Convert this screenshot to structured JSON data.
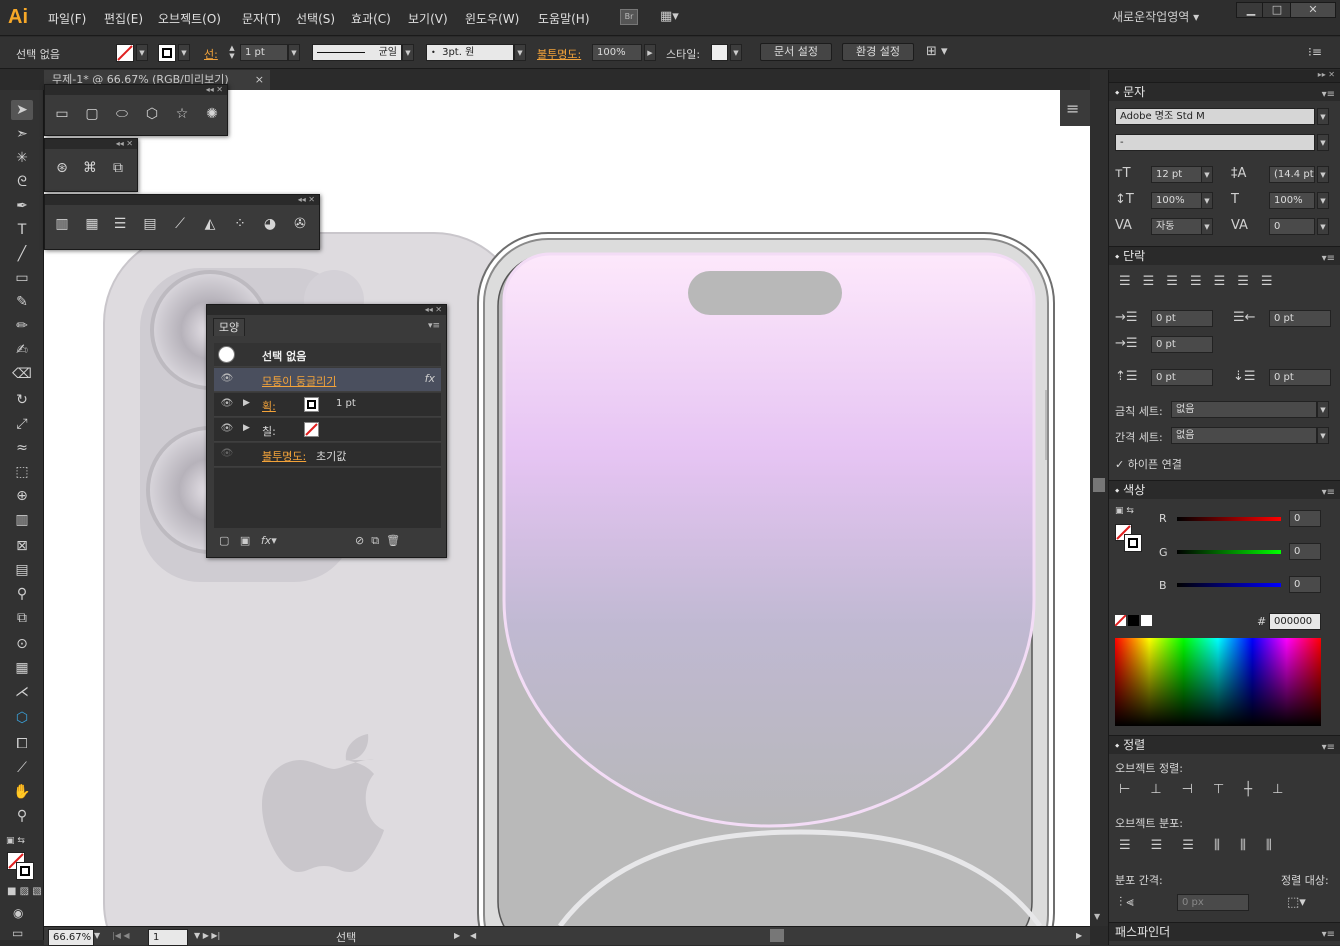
{
  "app": {
    "logo": "Ai",
    "workspace": "새로운작업영역",
    "bridge": "Br",
    "win_min": "▁",
    "win_max": "□",
    "win_close": "✕"
  },
  "menu": [
    "파일(F)",
    "편집(E)",
    "오브젝트(O)",
    "문자(T)",
    "선택(S)",
    "효과(C)",
    "보기(V)",
    "윈도우(W)",
    "도움말(H)"
  ],
  "control": {
    "selection": "선택 없음",
    "stroke_label": "선:",
    "stroke_weight": "1 pt",
    "stroke_profile": "균일",
    "brush": "3pt. 원",
    "opacity_label": "불투명도:",
    "opacity": "100%",
    "style_label": "스타일:",
    "doc_setup": "문서 설정",
    "prefs": "환경 설정"
  },
  "doc_tab": {
    "title": "무제-1* @ 66.67% (RGB/미리보기)",
    "close": "×"
  },
  "appearance": {
    "tab": "모양",
    "none": "선택 없음",
    "effect": "모퉁이 둥글리기",
    "fx": "fx",
    "stroke_label": "획:",
    "stroke_value": "1 pt",
    "fill_label": "칠:",
    "opacity_label": "불투명도:",
    "opacity_value": "초기값"
  },
  "character": {
    "title": "문자",
    "font": "Adobe 명조 Std M",
    "style": "-",
    "size": "12 pt",
    "leading": "(14.4 pt)",
    "vscale": "100%",
    "hscale": "100%",
    "kerning": "자동",
    "tracking": "0"
  },
  "paragraph": {
    "title": "단락",
    "indent_left": "0 pt",
    "indent_right": "0 pt",
    "first_line": "0 pt",
    "space_before": "0 pt",
    "space_after": "0 pt",
    "kinsoku_label": "금칙 세트:",
    "kinsoku_value": "없음",
    "mojikumi_label": "간격 세트:",
    "mojikumi_value": "없음",
    "hyphen": "하이픈 연결"
  },
  "color": {
    "title": "색상",
    "r_label": "R",
    "g_label": "G",
    "b_label": "B",
    "r": "0",
    "g": "0",
    "b": "0",
    "hash": "#",
    "hex": "000000"
  },
  "align": {
    "title": "정렬",
    "align_objects": "오브젝트 정렬:",
    "distribute_objects": "오브젝트 분포:",
    "distribute_spacing": "분포 간격:",
    "align_to": "정렬 대상:",
    "spacing_value": "0 px"
  },
  "pathfinder": {
    "title": "패스파인더"
  },
  "status": {
    "zoom": "66.67%",
    "artboard": "1",
    "tool": "선택"
  }
}
